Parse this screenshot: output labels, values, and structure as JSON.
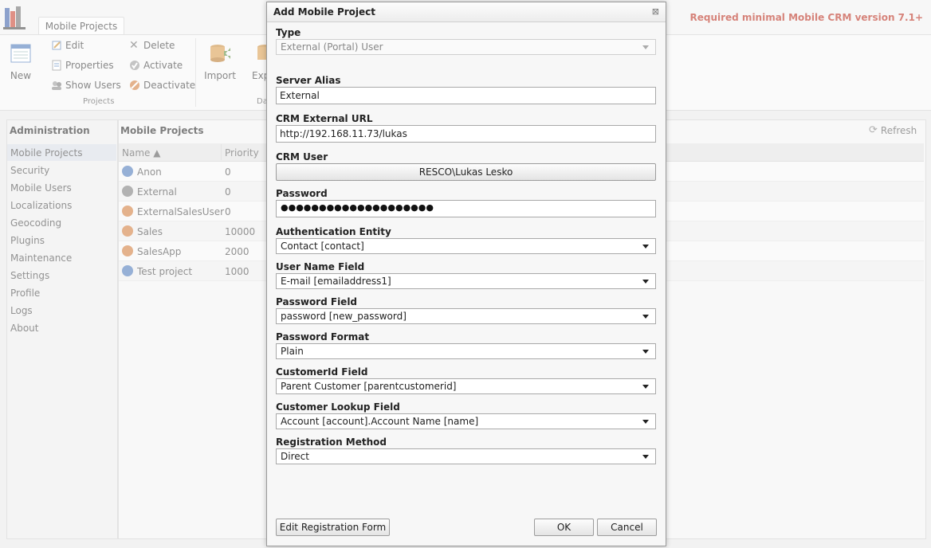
{
  "app": {
    "tab": "Mobile Projects",
    "required_version": "Required minimal Mobile CRM version 7.1+"
  },
  "ribbon": {
    "new": "New",
    "edit": "Edit",
    "properties": "Properties",
    "show_users": "Show Users",
    "delete": "Delete",
    "activate": "Activate",
    "deactivate": "Deactivate",
    "group_projects": "Projects",
    "import": "Import",
    "export_partial": "Exp",
    "group_data_partial": "Da"
  },
  "admin": {
    "title": "Administration",
    "items": [
      "Mobile Projects",
      "Security",
      "Mobile Users",
      "Localizations",
      "Geocoding",
      "Plugins",
      "Maintenance",
      "Settings",
      "Profile",
      "Logs",
      "About"
    ]
  },
  "projects": {
    "title": "Mobile Projects",
    "refresh": "Refresh",
    "columns": {
      "name": "Name ▲",
      "priority": "Priority"
    },
    "rows": [
      {
        "name": "Anon",
        "priority": "0",
        "icon": "info-icon"
      },
      {
        "name": "External",
        "priority": "0",
        "icon": "info-icon"
      },
      {
        "name": "ExternalSalesUser",
        "priority": "0",
        "icon": "disabled-icon"
      },
      {
        "name": "Sales",
        "priority": "10000",
        "icon": "disabled-icon"
      },
      {
        "name": "SalesApp",
        "priority": "2000",
        "icon": "disabled-icon"
      },
      {
        "name": "Test project",
        "priority": "1000",
        "icon": "info-icon"
      }
    ]
  },
  "dialog": {
    "title": "Add Mobile Project",
    "close": "⊠",
    "type_label": "Type",
    "type_value": "External (Portal) User",
    "server_alias_label": "Server Alias",
    "server_alias_value": "External",
    "crm_url_label": "CRM External URL",
    "crm_url_value": "http://192.168.11.73/lukas",
    "crm_user_label": "CRM User",
    "crm_user_value": "RESCO\\Lukas Lesko",
    "password_label": "Password",
    "password_mask": "●●●●●●●●●●●●●●●●●●●●",
    "auth_entity_label": "Authentication Entity",
    "auth_entity_value": "Contact [contact]",
    "username_field_label": "User Name Field",
    "username_field_value": "E-mail [emailaddress1]",
    "password_field_label": "Password Field",
    "password_field_value": "password [new_password]",
    "password_format_label": "Password Format",
    "password_format_value": "Plain",
    "customerid_label": "CustomerId Field",
    "customerid_value": "Parent Customer [parentcustomerid]",
    "customer_lookup_label": "Customer Lookup Field",
    "customer_lookup_value": "Account [account].Account Name [name]",
    "registration_label": "Registration Method",
    "registration_value": "Direct",
    "edit_form_button": "Edit Registration Form",
    "ok_button": "OK",
    "cancel_button": "Cancel"
  }
}
